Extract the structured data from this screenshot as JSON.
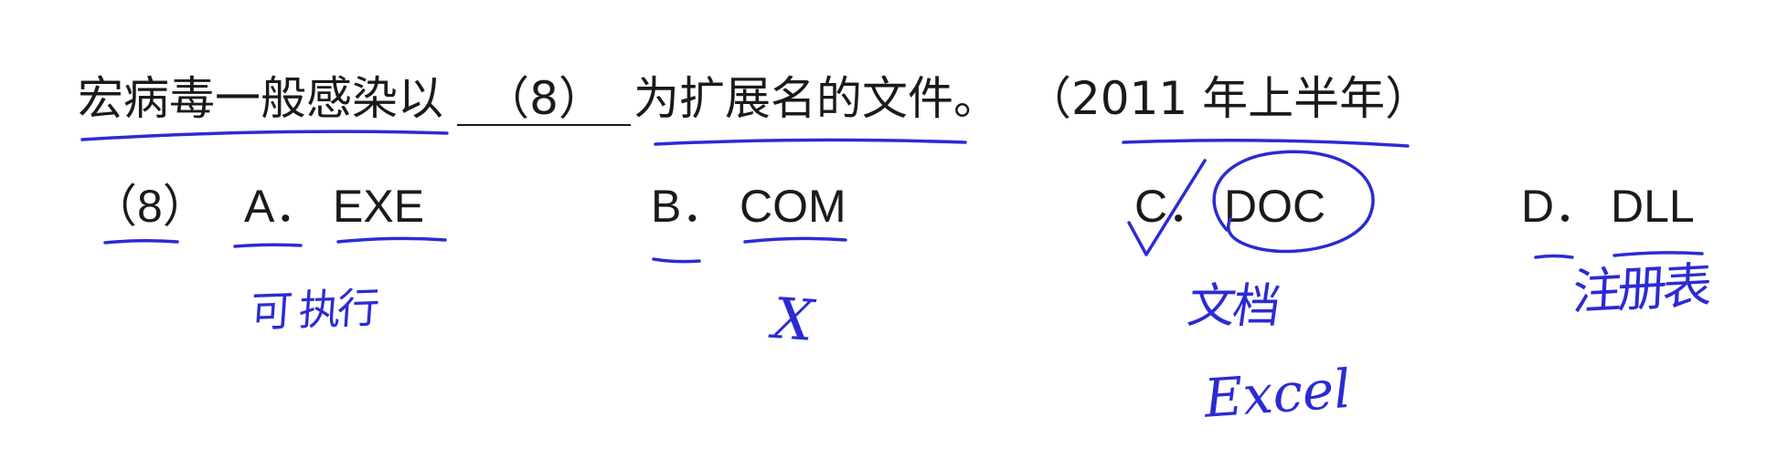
{
  "question": {
    "stem_before": "宏病毒一般感染以",
    "blank": "（8）",
    "stem_after": "为扩展名的文件。",
    "source": "（2011 年上半年）"
  },
  "options": {
    "number": "（8）",
    "items": [
      {
        "letter": "A．",
        "text": "EXE"
      },
      {
        "letter": "B．",
        "text": "COM"
      },
      {
        "letter": "C．",
        "text": "DOC"
      },
      {
        "letter": "D．",
        "text": "DLL"
      }
    ]
  },
  "handwriting": {
    "a_note": "可 执行",
    "b_note": "X",
    "c_note": "文档",
    "c_note_2": "Excel",
    "d_note": "注册表"
  },
  "colors": {
    "ink": "#1a1a1a",
    "pen": "#2b2bd4",
    "background": "#ffffff"
  }
}
